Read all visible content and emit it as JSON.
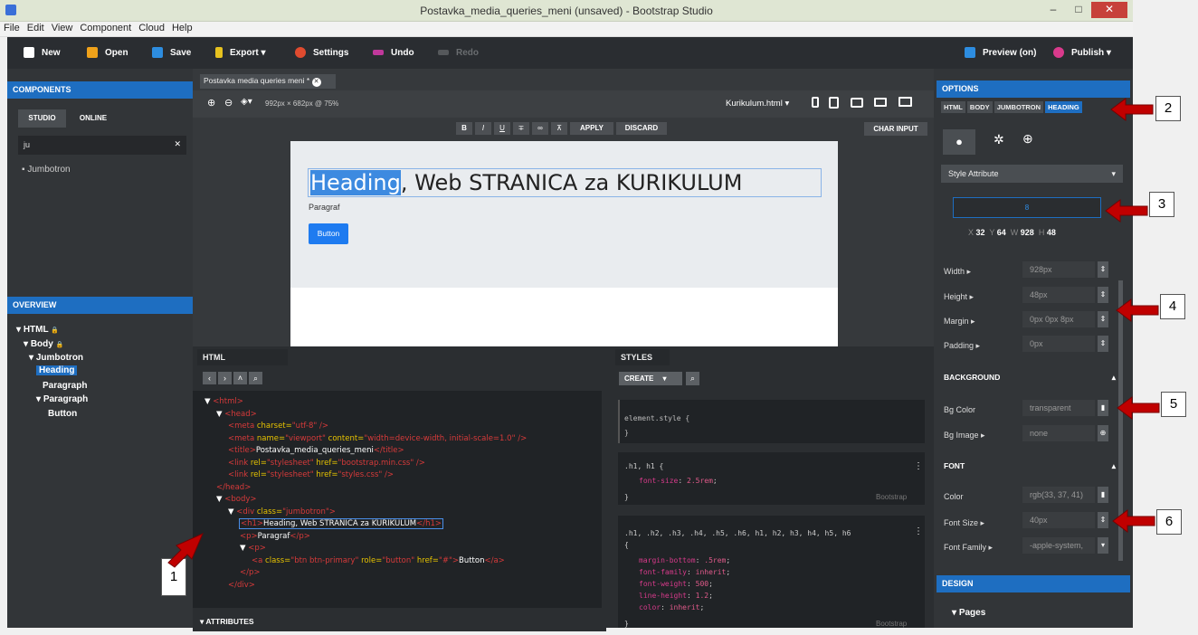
{
  "window": {
    "title": "Postavka_media_queries_meni (unsaved) - Bootstrap Studio",
    "minimize": "–",
    "maximize": "□",
    "close": "✕"
  },
  "menu": [
    "File",
    "Edit",
    "View",
    "Component",
    "Cloud",
    "Help"
  ],
  "toolbar": {
    "new": "New",
    "open": "Open",
    "save": "Save",
    "export": "Export",
    "settings": "Settings",
    "undo": "Undo",
    "redo": "Redo",
    "preview": "Preview (on)",
    "publish": "Publish"
  },
  "components": {
    "title": "COMPONENTS",
    "tab_studio": "STUDIO",
    "tab_online": "ONLINE",
    "search_value": "ju",
    "results": [
      "Jumbotron"
    ]
  },
  "overview": {
    "title": "OVERVIEW",
    "tree": [
      {
        "label": "HTML",
        "lock": "🔒"
      },
      {
        "label": "Body",
        "lock": "🔒"
      },
      {
        "label": "Jumbotron"
      },
      {
        "label": "Heading"
      },
      {
        "label": "Paragraph"
      },
      {
        "label": "Paragraph"
      },
      {
        "label": "Button"
      }
    ]
  },
  "editor": {
    "tab": "Postavka media queries meni *",
    "size": "992px × 682px @ 75%",
    "page_select": "Kurikulum.html",
    "format": [
      "B",
      "I",
      "U",
      "∓",
      "∞",
      "⊼",
      "APPLY",
      "DISCARD"
    ],
    "char_input": "CHAR INPUT",
    "heading_selected": "Heading",
    "heading_rest": ", Web STRANICA za KURIKULUM",
    "paragraph": "Paragraf",
    "button": "Button"
  },
  "html_panel": {
    "title": "HTML",
    "lines": [
      {
        "pre": "▼ ",
        "tag": "<html>"
      },
      {
        "pre": "▼ ",
        "tag": "<head>"
      },
      {
        "tag": "<meta ",
        "attr": "charset=",
        "val": "\"utf-8\"",
        "end": " />"
      },
      {
        "tag": "<meta ",
        "attr": "name=",
        "val": "\"viewport\"",
        "attr2": " content=",
        "val2": "\"width=device-width, initial-scale=1.0\"",
        "end": " />"
      },
      {
        "tag": "<title>",
        "text": "Postavka_media_queries_meni",
        "end": "</title>"
      },
      {
        "tag": "<link ",
        "attr": "rel=",
        "val": "\"stylesheet\"",
        "attr2": " href=",
        "val2": "\"bootstrap.min.css\"",
        "end": " />"
      },
      {
        "tag": "<link ",
        "attr": "rel=",
        "val": "\"stylesheet\"",
        "attr2": " href=",
        "val2": "\"styles.css\"",
        "end": " />"
      },
      {
        "tag": "</head>"
      },
      {
        "pre": "▼ ",
        "tag": "<body>"
      },
      {
        "pre": "▼ ",
        "tag": "<div ",
        "attr": "class=",
        "val": "\"jumbotron\"",
        "end": ">"
      },
      {
        "tag": "<h1>",
        "text": "Heading, Web STRANICA za KURIKULUM",
        "end": "</h1>"
      },
      {
        "tag": "<p>",
        "text": "Paragraf",
        "end": "</p>"
      },
      {
        "pre": "▼ ",
        "tag": "<p>"
      },
      {
        "tag": "<a ",
        "attr": "class=",
        "val": "\"btn btn-primary\"",
        "attr2": " role=",
        "val2": "\"button\"",
        "attr3": " href=",
        "val3": "\"#\"",
        "end": ">",
        "text": "Button",
        "end2": "</a>"
      },
      {
        "tag": "</p>"
      },
      {
        "tag": "</div>"
      }
    ],
    "attributes": "ATTRIBUTES"
  },
  "styles": {
    "title": "STYLES",
    "create": "CREATE",
    "rules": [
      {
        "selector": "element.style {",
        "close": "}"
      },
      {
        "selector": ".h1, h1 {",
        "props": [
          [
            "font-size",
            "2.5rem"
          ]
        ],
        "close": "}",
        "source": "Bootstrap"
      },
      {
        "selector": ".h1, .h2, .h3, .h4, .h5, .h6, h1, h2, h3, h4, h5, h6",
        "open": "{",
        "props": [
          [
            "margin-bottom",
            ".5rem"
          ],
          [
            "font-family",
            "inherit"
          ],
          [
            "font-weight",
            "500"
          ],
          [
            "line-height",
            "1.2"
          ],
          [
            "color",
            "inherit"
          ]
        ],
        "close": "}",
        "source": "Bootstrap"
      }
    ]
  },
  "options": {
    "title": "OPTIONS",
    "crumbs": [
      "HTML",
      "BODY",
      "JUMBOTRON",
      "HEADING"
    ],
    "style_attr": "Style Attribute",
    "box_value": "8",
    "dims": [
      [
        "X",
        "32"
      ],
      [
        "Y",
        "64"
      ],
      [
        "W",
        "928"
      ],
      [
        "H",
        "48"
      ]
    ],
    "rows": [
      [
        "Width ▸",
        "928px"
      ],
      [
        "Height ▸",
        "48px"
      ],
      [
        "Margin ▸",
        "0px 0px 8px"
      ],
      [
        "Padding ▸",
        "0px"
      ]
    ],
    "background": "BACKGROUND",
    "bg_rows": [
      [
        "Bg Color",
        "transparent"
      ],
      [
        "Bg Image ▸",
        "none"
      ]
    ],
    "font": "FONT",
    "font_rows": [
      [
        "Color",
        "rgb(33, 37, 41)"
      ],
      [
        "Font Size ▸",
        "40px"
      ],
      [
        "Font Family ▸",
        "-apple-system,"
      ]
    ]
  },
  "design": {
    "title": "DESIGN",
    "pages": "Pages"
  },
  "callouts": [
    "1",
    "2",
    "3",
    "4",
    "5",
    "6"
  ],
  "colors": {
    "accent": "#1e6ec1",
    "arrow": "#c00000"
  }
}
